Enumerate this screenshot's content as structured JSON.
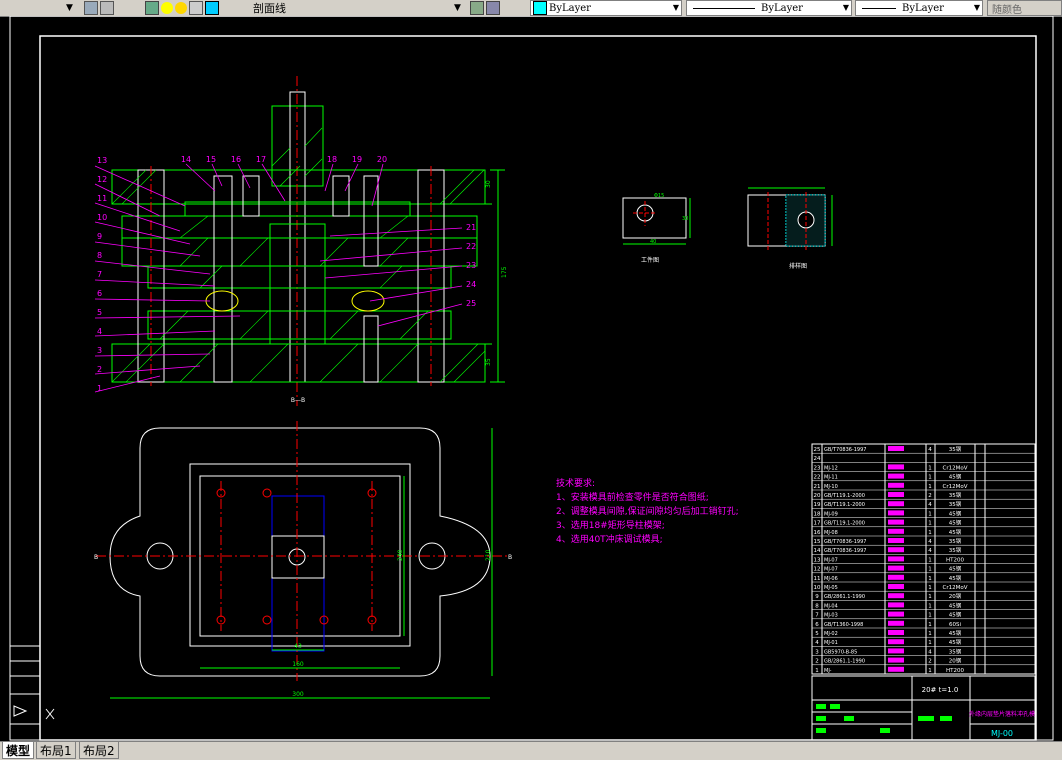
{
  "toolbar": {
    "layer_name": "剖面线",
    "color_value": "ByLayer",
    "linetype_value": "ByLayer",
    "lineweight_value": "ByLayer",
    "plotstyle_value": "随颜色"
  },
  "tabs": [
    "模型",
    "布局1",
    "布局2"
  ],
  "drawing": {
    "part_numbers_left": [
      "13",
      "12",
      "11",
      "10",
      "9",
      "8",
      "7",
      "6",
      "5",
      "4",
      "3",
      "2",
      "1"
    ],
    "part_numbers_top": [
      "14",
      "15",
      "16",
      "17",
      "18",
      "19",
      "20"
    ],
    "part_numbers_right": [
      "21",
      "22",
      "23",
      "24",
      "25"
    ],
    "section_label": "B—B",
    "dims_right": [
      "30",
      "175",
      "35"
    ],
    "workpiece_label": "工件图",
    "layout_label": "排样图",
    "workpiece_dims": [
      "Φ15",
      "30",
      "40"
    ],
    "plan_dims": [
      "43",
      "160",
      "300",
      "240",
      "210",
      "B",
      "B"
    ],
    "tech_title": "技术要求:",
    "tech_items": [
      "1、安装模具前检查零件是否符合图纸;",
      "2、调整模具间隙,保证间隙均匀后加工销钉孔;",
      "3、选用18#矩形导柱模架;",
      "4、选用40T冲床调试模具;"
    ]
  },
  "bom": {
    "rows": [
      {
        "no": "25",
        "code": "GB/T70836-1997",
        "qty": "4",
        "mat": "35钢"
      },
      {
        "no": "24",
        "code": "",
        "qty": "",
        "mat": ""
      },
      {
        "no": "23",
        "code": "MJ-12",
        "qty": "1",
        "mat": "Cr12MoV"
      },
      {
        "no": "22",
        "code": "MJ-11",
        "qty": "1",
        "mat": "45钢"
      },
      {
        "no": "21",
        "code": "MJ-10",
        "qty": "1",
        "mat": "Cr12MoV"
      },
      {
        "no": "20",
        "code": "GB/T119.1-2000",
        "qty": "2",
        "mat": "35钢"
      },
      {
        "no": "19",
        "code": "GB/T119.1-2000",
        "qty": "4",
        "mat": "35钢"
      },
      {
        "no": "18",
        "code": "MJ-09",
        "qty": "1",
        "mat": "45钢"
      },
      {
        "no": "17",
        "code": "GB/T119.1-2000",
        "qty": "1",
        "mat": "45钢"
      },
      {
        "no": "16",
        "code": "MJ-08",
        "qty": "1",
        "mat": "45钢"
      },
      {
        "no": "15",
        "code": "GB/T70836-1997",
        "qty": "4",
        "mat": "35钢"
      },
      {
        "no": "14",
        "code": "GB/T70836-1997",
        "qty": "4",
        "mat": "35钢"
      },
      {
        "no": "13",
        "code": "MJ-07",
        "qty": "1",
        "mat": "HT200"
      },
      {
        "no": "12",
        "code": "MJ-07",
        "qty": "1",
        "mat": "45钢"
      },
      {
        "no": "11",
        "code": "MJ-06",
        "qty": "1",
        "mat": "45钢"
      },
      {
        "no": "10",
        "code": "MJ-05",
        "qty": "1",
        "mat": "Cr12MoV"
      },
      {
        "no": "9",
        "code": "GB/2861.1-1990",
        "qty": "1",
        "mat": "20钢"
      },
      {
        "no": "8",
        "code": "MJ-04",
        "qty": "1",
        "mat": "45钢"
      },
      {
        "no": "7",
        "code": "MJ-03",
        "qty": "1",
        "mat": "45钢"
      },
      {
        "no": "6",
        "code": "GB/T1360-1998",
        "qty": "1",
        "mat": "60Si"
      },
      {
        "no": "5",
        "code": "MJ-02",
        "qty": "1",
        "mat": "45钢"
      },
      {
        "no": "4",
        "code": "MJ-01",
        "qty": "1",
        "mat": "45钢"
      },
      {
        "no": "3",
        "code": "GB5970-B-85",
        "qty": "4",
        "mat": "35钢"
      },
      {
        "no": "2",
        "code": "GB/2861.1-1990",
        "qty": "2",
        "mat": "20钢"
      },
      {
        "no": "1",
        "code": "MJ-",
        "qty": "1",
        "mat": "HT200"
      }
    ],
    "title_spec": "20# t=1.0",
    "title_name": "外缘内层垫片落料冲孔模",
    "drawing_no": "MJ-00"
  },
  "colors": {
    "bg": "#000000",
    "frame": "#ffffff",
    "yellow": "#ffff00",
    "green": "#00ff00",
    "cyan": "#00ffff",
    "magenta": "#ff00ff",
    "red": "#ff0000",
    "blue": "#0000ff"
  }
}
